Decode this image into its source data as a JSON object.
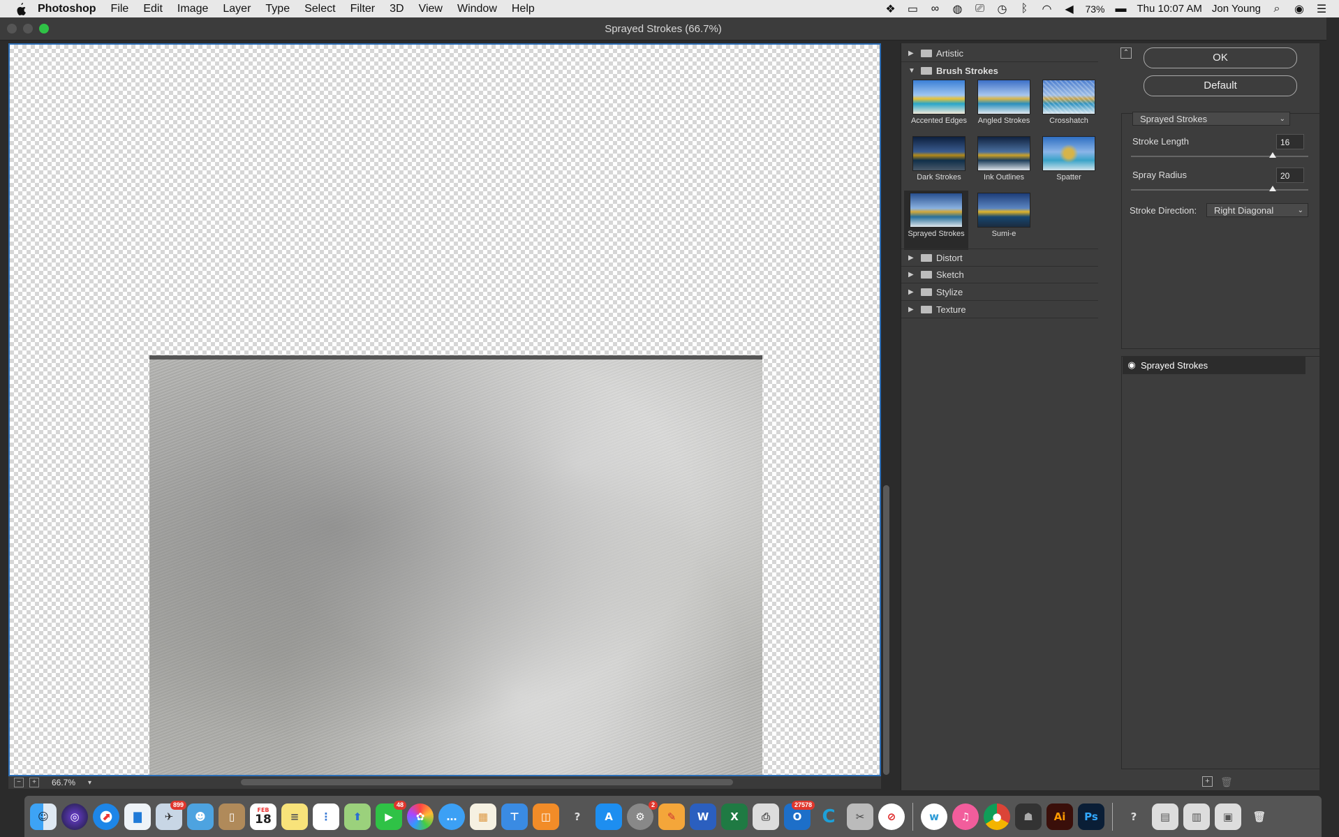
{
  "menubar": {
    "app": "Photoshop",
    "items": [
      "File",
      "Edit",
      "Image",
      "Layer",
      "Type",
      "Select",
      "Filter",
      "3D",
      "View",
      "Window",
      "Help"
    ],
    "battery": "73%",
    "clock": "Thu 10:07 AM",
    "user": "Jon Young"
  },
  "window": {
    "title": "Sprayed Strokes (66.7%)"
  },
  "preview": {
    "zoom": "66.7%"
  },
  "gallery": {
    "categories_top": [
      {
        "label": "Artistic",
        "expanded": false
      },
      {
        "label": "Brush Strokes",
        "expanded": true
      }
    ],
    "filters": [
      {
        "label": "Accented Edges"
      },
      {
        "label": "Angled Strokes"
      },
      {
        "label": "Crosshatch"
      },
      {
        "label": "Dark Strokes"
      },
      {
        "label": "Ink Outlines"
      },
      {
        "label": "Spatter"
      },
      {
        "label": "Sprayed Strokes",
        "selected": true
      },
      {
        "label": "Sumi-e"
      }
    ],
    "categories_bottom": [
      "Distort",
      "Sketch",
      "Stylize",
      "Texture"
    ]
  },
  "settings": {
    "ok_label": "OK",
    "default_label": "Default",
    "filter_select": "Sprayed Strokes",
    "stroke_length_label": "Stroke Length",
    "stroke_length_value": "16",
    "stroke_length_fraction": 0.8,
    "spray_radius_label": "Spray Radius",
    "spray_radius_value": "20",
    "spray_radius_fraction": 0.8,
    "stroke_direction_label": "Stroke Direction:",
    "stroke_direction_value": "Right Diagonal",
    "effect_layer": "Sprayed Strokes"
  },
  "dock": {
    "badges": {
      "mail": "899",
      "facetime": "48",
      "sysprefs": "2",
      "outlook": "27578"
    },
    "calendar_day": "18",
    "calendar_month": "FEB"
  },
  "colors": {
    "accent": "#2d6fb7",
    "panel": "#3d3d3d"
  }
}
